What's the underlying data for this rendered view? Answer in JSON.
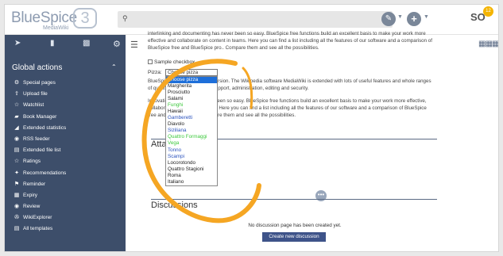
{
  "brand": {
    "name": "BlueSpice",
    "version": "3",
    "sub": "MediaWiki"
  },
  "topbar": {
    "search_icon": "search-icon",
    "avatar_initials": "SO",
    "avatar_badge": "12"
  },
  "sidebar": {
    "title": "Global actions",
    "items": [
      {
        "icon": "⚙",
        "label": "Special pages"
      },
      {
        "icon": "⇪",
        "label": "Upload file"
      },
      {
        "icon": "☆",
        "label": "Watchlist"
      },
      {
        "icon": "▰",
        "label": "Book Manager"
      },
      {
        "icon": "◢",
        "label": "Extended statistics"
      },
      {
        "icon": "◉",
        "label": "RSS feeder"
      },
      {
        "icon": "▤",
        "label": "Extended file list"
      },
      {
        "icon": "☆",
        "label": "Ratings"
      },
      {
        "icon": "✦",
        "label": "Recommendations"
      },
      {
        "icon": "⚑",
        "label": "Reminder"
      },
      {
        "icon": "▦",
        "label": "Expiry"
      },
      {
        "icon": "◉",
        "label": "Review"
      },
      {
        "icon": "✇",
        "label": "WikiExplorer"
      },
      {
        "icon": "▤",
        "label": "All templates"
      }
    ]
  },
  "content": {
    "para1": "interlinking and documenting has never been so easy. BlueSpice free functions build an excellent basis to make your work more effective and collaborate on content in teams. Here you can find a list including all the features of our software and a comparison of BlueSpice free and BlueSpice pro.. Compare them and see all the possibilities.",
    "checkbox_label": "Sample checkbox",
    "pizza_label": "Pizza:",
    "pizza_selected": "Choose pizza",
    "para2": "BlueSpice free of charge wiki version. The Wikipedia software MediaWiki is extended with lots of useful features and whole ranges of quality assurance, process support, administration, editing and security.",
    "para3": "Innovations, editing has never been so easy. BlueSpice free functions build an excellent basis to make your work more effective, collaborate on content in teams. Here you can find a list including all the features of our software and a comparison of BlueSpice free and BlueSpice pro.. Compare them and see all the possibilities.",
    "pizza_options": [
      {
        "label": "Choose pizza",
        "color": "#ffffff",
        "selected": true
      },
      {
        "label": "Margherita",
        "color": "#222222"
      },
      {
        "label": "Prosciutto",
        "color": "#222222"
      },
      {
        "label": "Salami",
        "color": "#222222"
      },
      {
        "label": "Funghi",
        "color": "#3ec93e"
      },
      {
        "label": "Hawaii",
        "color": "#222222"
      },
      {
        "label": "Gamberetti",
        "color": "#2a52be"
      },
      {
        "label": "Diavolo",
        "color": "#222222"
      },
      {
        "label": "Siziliana",
        "color": "#2a52be"
      },
      {
        "label": "Quattro Formaggi",
        "color": "#3ec93e"
      },
      {
        "label": "Vega",
        "color": "#3ec93e"
      },
      {
        "label": "Tonno",
        "color": "#2a52be"
      },
      {
        "label": "Scampi",
        "color": "#2a52be"
      },
      {
        "label": "Locorotondo",
        "color": "#222222"
      },
      {
        "label": "Quattro Stagioni",
        "color": "#222222"
      },
      {
        "label": "Roma",
        "color": "#222222"
      },
      {
        "label": "Italiano",
        "color": "#222222"
      }
    ],
    "attachments_title": "Atta",
    "discussions_title": "Discussions",
    "no_discussion_text": "No discussion page has been created yet.",
    "create_discussion_label": "Create new discussion"
  },
  "colors": {
    "sidebar_bg": "#3d4e6a",
    "highlight_circle": "#f5a623",
    "create_button": "#3e5389"
  }
}
